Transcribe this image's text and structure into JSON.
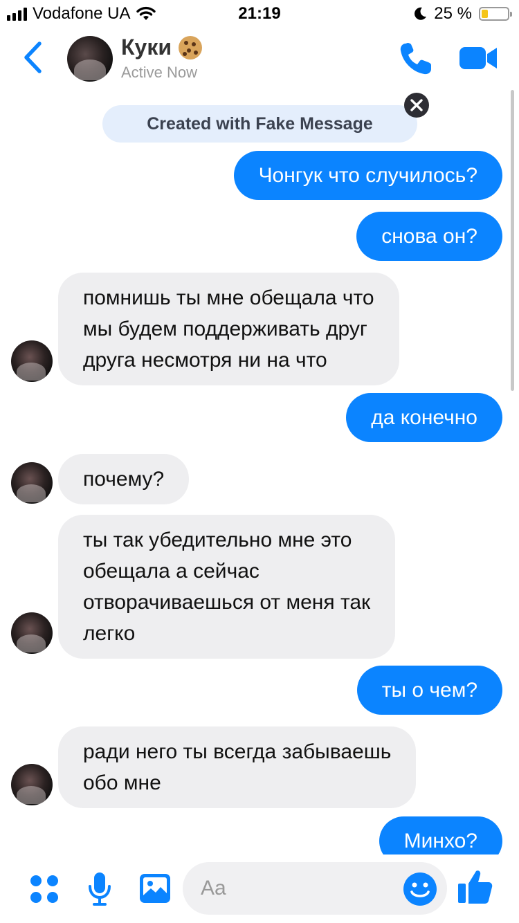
{
  "status_bar": {
    "carrier": "Vodafone UA",
    "time": "21:19",
    "battery_text": "25 %",
    "battery_level": 0.25,
    "battery_color": "#f5c518"
  },
  "header": {
    "back_icon": "chevron-left-icon",
    "contact_name": "Куки",
    "name_emoji": "cookie-icon",
    "presence": "Active Now",
    "call_icon": "phone-icon",
    "video_icon": "video-camera-icon",
    "accent_color": "#0b84ff"
  },
  "banner": {
    "text": "Created with Fake Message",
    "close_icon": "close-icon"
  },
  "messages": [
    {
      "side": "out",
      "text": "Чонгук что случилось?"
    },
    {
      "side": "out",
      "text": "снова он?"
    },
    {
      "side": "in",
      "lines": [
        "помнишь ты мне обещала что",
        "мы будем поддерживать друг",
        "друга несмотря ни на что"
      ]
    },
    {
      "side": "out",
      "text": "да конечно"
    },
    {
      "side": "in",
      "lines": [
        "почему?"
      ]
    },
    {
      "side": "in",
      "lines": [
        "ты так убедительно мне это",
        "обещала а сейчас",
        "отворачиваешься от меня так",
        "легко"
      ]
    },
    {
      "side": "out",
      "text": "ты о чем?"
    },
    {
      "side": "in",
      "lines": [
        "ради него ты всегда забываешь",
        "обо мне"
      ]
    },
    {
      "side": "out",
      "text": "Минхо?"
    }
  ],
  "composer": {
    "apps_icon": "apps-grid-icon",
    "mic_icon": "microphone-icon",
    "photo_icon": "photo-icon",
    "placeholder": "Aa",
    "emoji_icon": "smiley-icon",
    "like_icon": "thumbs-up-icon"
  }
}
